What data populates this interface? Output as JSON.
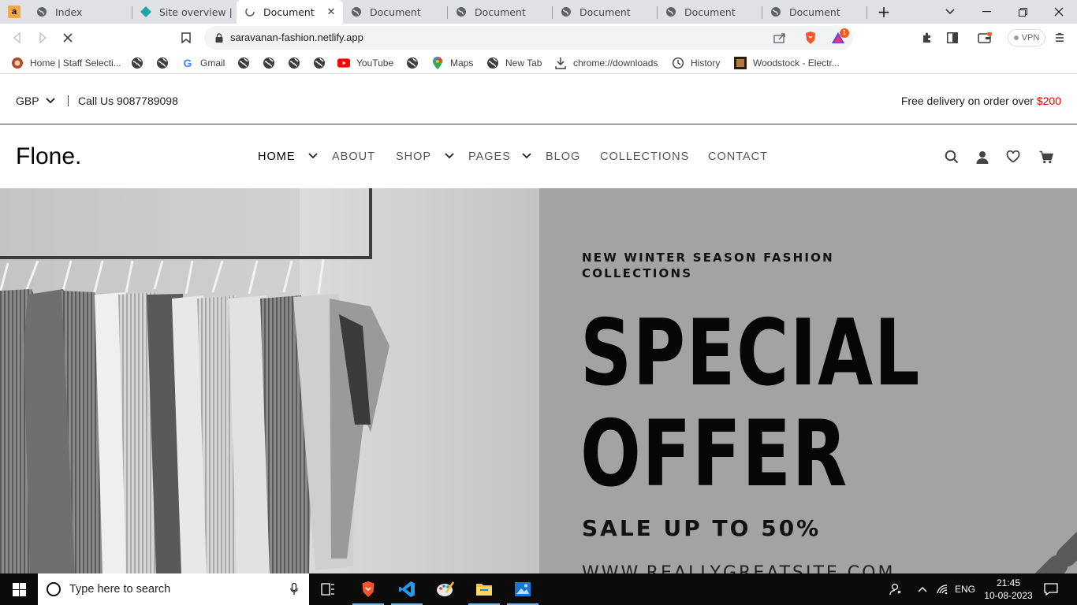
{
  "browser": {
    "tabs": [
      {
        "title": "Index",
        "icon": "globe-icon"
      },
      {
        "title": "Site overview | sar",
        "icon": "netlify-icon"
      },
      {
        "title": "Document",
        "icon": "loading-icon",
        "active": true
      },
      {
        "title": "Document",
        "icon": "globe-icon"
      },
      {
        "title": "Document",
        "icon": "globe-icon"
      },
      {
        "title": "Document",
        "icon": "globe-icon"
      },
      {
        "title": "Document",
        "icon": "globe-icon"
      },
      {
        "title": "Document",
        "icon": "globe-icon"
      }
    ],
    "new_tab_label": "+",
    "url": "saravanan-fashion.netlify.app",
    "notification_count": "1",
    "vpn_label": "VPN",
    "bookmarks": [
      {
        "label": "Home | Staff Selecti...",
        "icon": "staff-icon"
      },
      {
        "label": "",
        "icon": "globe-icon"
      },
      {
        "label": "",
        "icon": "globe-icon"
      },
      {
        "label": "Gmail",
        "icon": "google-icon"
      },
      {
        "label": "",
        "icon": "globe-icon"
      },
      {
        "label": "",
        "icon": "globe-icon"
      },
      {
        "label": "",
        "icon": "globe-icon"
      },
      {
        "label": "",
        "icon": "globe-icon"
      },
      {
        "label": "YouTube",
        "icon": "youtube-icon"
      },
      {
        "label": "",
        "icon": "globe-icon"
      },
      {
        "label": "Maps",
        "icon": "maps-pin-icon"
      },
      {
        "label": "New Tab",
        "icon": "globe-icon"
      },
      {
        "label": "chrome://downloads",
        "icon": "download-icon"
      },
      {
        "label": "History",
        "icon": "history-icon"
      },
      {
        "label": "Woodstock - Electr...",
        "icon": "woodstock-icon"
      }
    ]
  },
  "site": {
    "topbar": {
      "currency": "GBP",
      "call": "Call Us 9087789098",
      "delivery_text": "Free delivery on order over",
      "delivery_amount": "$200"
    },
    "logo": "Flone.",
    "nav": {
      "home": "HOME",
      "about": "ABOUT",
      "shop": "SHOP",
      "pages": "PAGES",
      "blog": "BLOG",
      "collections": "COLLECTIONS",
      "contact": "CONTACT"
    },
    "hero": {
      "kicker": "NEW WINTER SEASON FASHION COLLECTIONS",
      "headline_line1": "SPECIAL",
      "headline_line2": "OFFER",
      "sale": "SALE UP TO 50%",
      "website": "WWW.REALLYGREATSITE.COM"
    }
  },
  "taskbar": {
    "search_placeholder": "Type here to search",
    "language": "ENG",
    "time": "21:45",
    "date": "10-08-2023"
  },
  "colors": {
    "accent_red": "#e40000",
    "hero_bg": "#a3a3a3",
    "taskbar": "#0b0b0b"
  }
}
